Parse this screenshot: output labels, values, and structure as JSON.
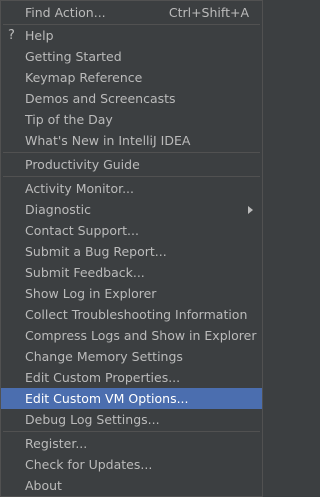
{
  "menu": {
    "find_action": {
      "label": "Find Action...",
      "shortcut": "Ctrl+Shift+A"
    },
    "help_icon": "?",
    "help": "Help",
    "getting_started": "Getting Started",
    "keymap_reference": "Keymap Reference",
    "demos": "Demos and Screencasts",
    "tip": "Tip of the Day",
    "whats_new": "What's New in IntelliJ IDEA",
    "productivity": "Productivity Guide",
    "activity_monitor": "Activity Monitor...",
    "diagnostic": "Diagnostic",
    "contact_support": "Contact Support...",
    "submit_bug": "Submit a Bug Report...",
    "submit_feedback": "Submit Feedback...",
    "show_log": "Show Log in Explorer",
    "collect_troubleshooting": "Collect Troubleshooting Information",
    "compress_logs": "Compress Logs and Show in Explorer",
    "change_memory": "Change Memory Settings",
    "edit_custom_properties": "Edit Custom Properties...",
    "edit_custom_vm": "Edit Custom VM Options...",
    "debug_log": "Debug Log Settings...",
    "register": "Register...",
    "check_updates": "Check for Updates...",
    "about": "About"
  },
  "colors": {
    "background": "#3c3f41",
    "selected": "#4b6eaf",
    "text": "#bbbbbb",
    "separator": "#515151"
  },
  "selected_item": "Edit Custom VM Options...",
  "icons": {
    "help": "question-mark-icon",
    "submenu": "submenu-arrow-icon"
  }
}
